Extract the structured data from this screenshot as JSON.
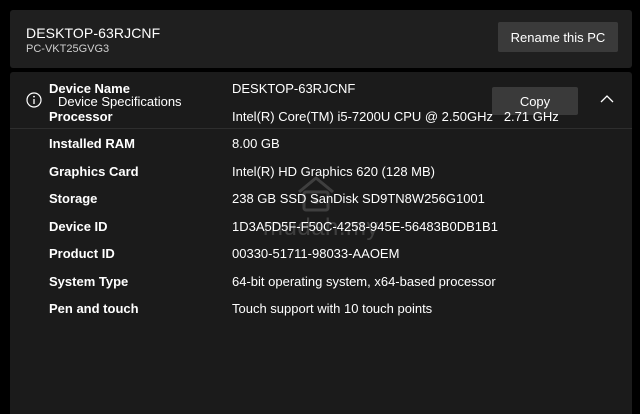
{
  "pc": {
    "name": "DESKTOP-63RJCNF",
    "model": "PC-VKT25GVG3",
    "rename_label": "Rename this PC"
  },
  "specs_section": {
    "title": "Device Specifications",
    "copy_label": "Copy",
    "expanded": true,
    "icons": {
      "info": "info-icon",
      "collapse": "chevron-up-icon"
    },
    "rows": [
      {
        "label": "Device Name",
        "value": "DESKTOP-63RJCNF"
      },
      {
        "label": "Processor",
        "value": "Intel(R) Core(TM) i5-7200U CPU @ 2.50GHz   2.71 GHz"
      },
      {
        "label": "Installed RAM",
        "value": "8.00 GB"
      },
      {
        "label": "Graphics Card",
        "value": "Intel(R) HD Graphics 620 (128 MB)"
      },
      {
        "label": "Storage",
        "value": "238 GB SSD SanDisk SD9TN8W256G1001"
      },
      {
        "label": "Device ID",
        "value": "1D3A5D5F-F50C-4258-945E-56483B0DB1B1"
      },
      {
        "label": "Product ID",
        "value": "00330-51711-98033-AAOEM"
      },
      {
        "label": "System Type",
        "value": "64-bit operating system, x64-based processor"
      },
      {
        "label": "Pen and touch",
        "value": "Touch support with 10 touch points"
      }
    ]
  },
  "watermark": {
    "text": "mudah.my"
  },
  "colors": {
    "background": "#000000",
    "card": "#1f1f1f",
    "button": "#3a3a3a",
    "text": "#ffffff"
  }
}
